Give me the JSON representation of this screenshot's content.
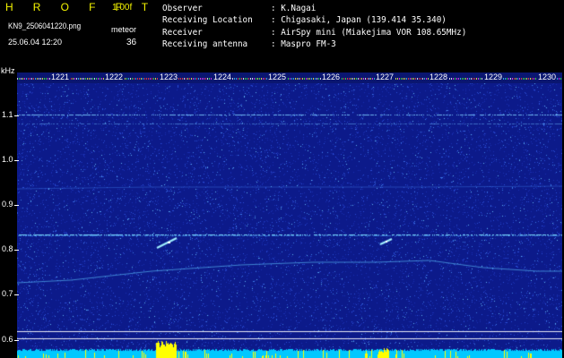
{
  "header": {
    "brand": "H R O F F T",
    "version": "1.00f",
    "filename": "KN9_2506041220.png",
    "datetime": "25.06.04 12:20",
    "shower": "meteor",
    "count": "36"
  },
  "info": [
    {
      "label": "Observer",
      "value": ": K.Nagai"
    },
    {
      "label": "Receiving Location",
      "value": ": Chigasaki, Japan (139.414 35.340)"
    },
    {
      "label": "Receiver",
      "value": ": AirSpy mini (Miakejima VOR 108.65MHz)"
    },
    {
      "label": "Receiving antenna",
      "value": ": Maspro FM-3"
    }
  ],
  "yaxis": {
    "unit": "kHz",
    "labels": [
      "1.1",
      "1.0",
      "0.9",
      "0.8",
      "0.7",
      "0.6"
    ]
  },
  "time_labels": [
    "1221",
    "1222",
    "1223",
    "1224",
    "1225",
    "1226",
    "1227",
    "1228",
    "1229",
    "1230"
  ],
  "colors": {
    "background": "#000000",
    "plot_blue": "#0c1a8a",
    "header_yellow": "#f4f400",
    "header_white": "#ffffff",
    "trace_cyan": "#66ccff",
    "noise_yellow": "#ffff00"
  }
}
